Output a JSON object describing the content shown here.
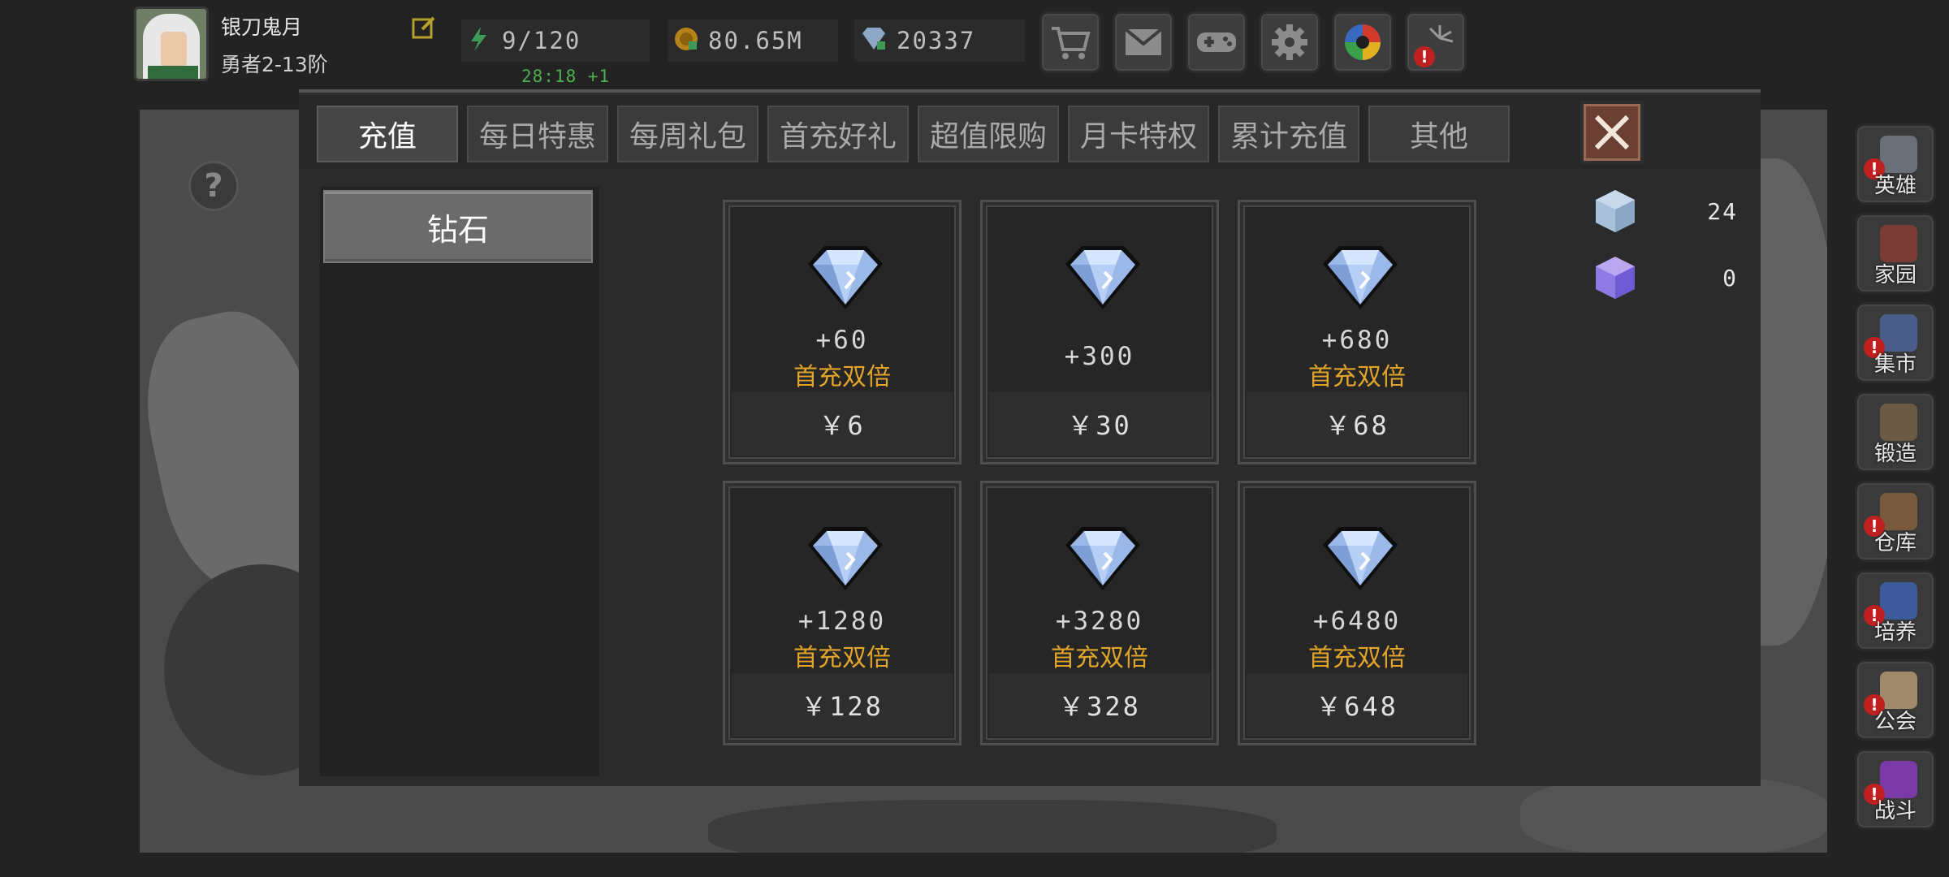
{
  "player": {
    "name": "银刀鬼月",
    "rank": "勇者2-13阶"
  },
  "resources": {
    "energy": "9/120",
    "energy_timer": "28:18 +1",
    "gold": "80.65M",
    "gems": "20337"
  },
  "top_buttons": [
    {
      "name": "shop",
      "icon": "cart-icon"
    },
    {
      "name": "mail",
      "icon": "mail-icon"
    },
    {
      "name": "gamepad",
      "icon": "gamepad-icon"
    },
    {
      "name": "settings",
      "icon": "gear-icon"
    },
    {
      "name": "camera",
      "icon": "aperture-icon"
    },
    {
      "name": "fireworks",
      "icon": "fireworks-icon",
      "alert": "!"
    }
  ],
  "tabs": [
    "充值",
    "每日特惠",
    "每周礼包",
    "首充好礼",
    "超值限购",
    "月卡特权",
    "累计充值",
    "其他"
  ],
  "active_tab": "充值",
  "category": "钻石",
  "currencies": [
    {
      "icon": "ice-cube-icon",
      "value": "24"
    },
    {
      "icon": "purple-cube-icon",
      "value": "0"
    }
  ],
  "packs": [
    {
      "amount": "+60",
      "bonus": "首充双倍",
      "price": "￥6"
    },
    {
      "amount": "+300",
      "bonus": "",
      "price": "￥30"
    },
    {
      "amount": "+680",
      "bonus": "首充双倍",
      "price": "￥68"
    },
    {
      "amount": "+1280",
      "bonus": "首充双倍",
      "price": "￥128"
    },
    {
      "amount": "+3280",
      "bonus": "首充双倍",
      "price": "￥328"
    },
    {
      "amount": "+6480",
      "bonus": "首充双倍",
      "price": "￥648"
    }
  ],
  "side_menu": [
    {
      "label": "英雄",
      "alert": "!",
      "color": "#6a6f7a"
    },
    {
      "label": "家园",
      "alert": "",
      "color": "#7a3b35"
    },
    {
      "label": "集市",
      "alert": "!",
      "color": "#4a5d8a"
    },
    {
      "label": "锻造",
      "alert": "",
      "color": "#6b5a44"
    },
    {
      "label": "仓库",
      "alert": "!",
      "color": "#7a5a3c"
    },
    {
      "label": "培养",
      "alert": "!",
      "color": "#3d5a9a"
    },
    {
      "label": "公会",
      "alert": "!",
      "color": "#a08a6a"
    },
    {
      "label": "战斗",
      "alert": "!",
      "color": "#7a3aa8"
    }
  ],
  "colors": {
    "bonus": "#e2a52a",
    "timer": "#4db04d",
    "close": "#6b4032"
  }
}
